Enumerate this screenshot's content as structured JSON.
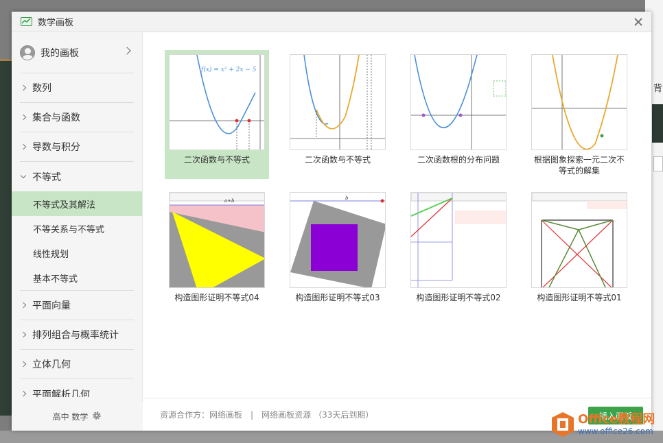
{
  "dialog": {
    "title": "数学画板",
    "close_icon": "close-icon"
  },
  "sidebar": {
    "my_board": "我的画板",
    "categories": [
      {
        "label": "数列"
      },
      {
        "label": "集合与函数"
      },
      {
        "label": "导数与积分"
      },
      {
        "label": "不等式",
        "expanded": true,
        "subs": [
          "不等式及其解法",
          "不等关系与不等式",
          "线性规划",
          "基本不等式"
        ],
        "active_sub": "不等式及其解法"
      },
      {
        "label": "平面向量"
      },
      {
        "label": "排列组合与概率统计"
      },
      {
        "label": "立体几何"
      },
      {
        "label": "平面解析几何"
      }
    ],
    "footer": "高中 数学"
  },
  "cards": [
    {
      "label": "二次函数与不等式",
      "formula": "f(x) = x² + 2x − 5",
      "selected": true
    },
    {
      "label": "二次函数与不等式"
    },
    {
      "label": "二次函数根的分布问题"
    },
    {
      "label": "根据图象探索一元二次不等式的解集"
    },
    {
      "label": "构造图形证明不等式04",
      "top_label": "a+b"
    },
    {
      "label": "构造图形证明不等式03",
      "top_label": "b"
    },
    {
      "label": "构造图形证明不等式02"
    },
    {
      "label": "构造图形证明不等式01"
    }
  ],
  "footer": {
    "source": "资源合作方：网络画板",
    "separator": "|",
    "resource": "网络画板资源",
    "expiry_open": "（",
    "expiry": "33天后到期",
    "expiry_close": "）",
    "insert_button": "插入画板"
  },
  "background": {
    "right_text": "背"
  },
  "watermark": {
    "line1": "Office教程网",
    "line2": "www.office26.com"
  },
  "colors": {
    "accent": "#3da34a",
    "selected": "#c8e6c6",
    "watermark_orange": "#e8762a"
  }
}
